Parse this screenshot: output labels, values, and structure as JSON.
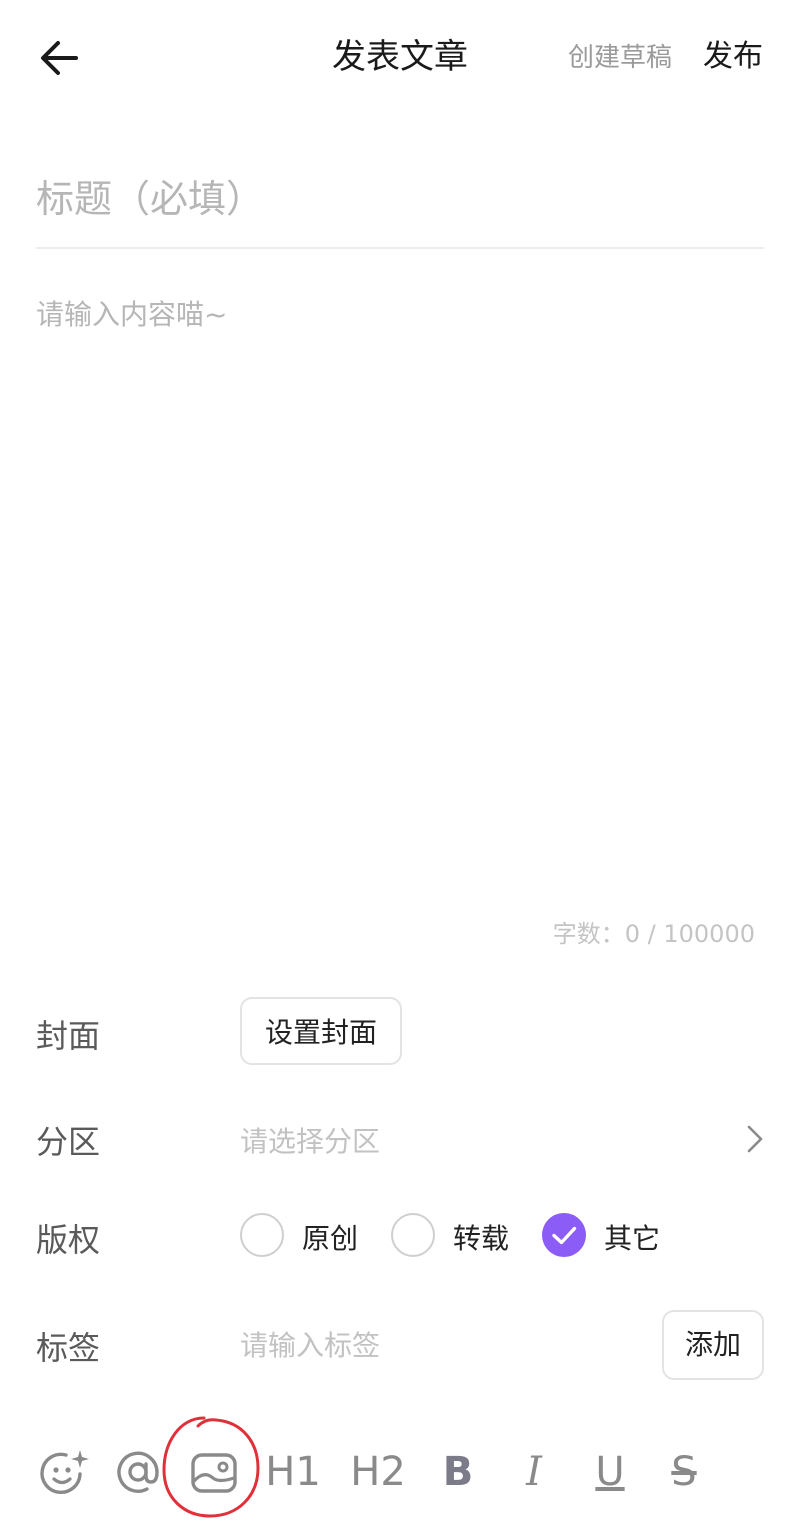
{
  "header": {
    "title": "发表文章",
    "draft_label": "创建草稿",
    "publish_label": "发布"
  },
  "editor": {
    "title_placeholder": "标题（必填）",
    "content_placeholder": "请输入内容喵~",
    "word_count": "字数：0 / 100000"
  },
  "form": {
    "cover": {
      "label": "封面",
      "button_label": "设置封面"
    },
    "partition": {
      "label": "分区",
      "placeholder": "请选择分区"
    },
    "copyright": {
      "label": "版权",
      "options": [
        {
          "label": "原创",
          "checked": false
        },
        {
          "label": "转载",
          "checked": false
        },
        {
          "label": "其它",
          "checked": true
        }
      ]
    },
    "tags": {
      "label": "标签",
      "placeholder": "请输入标签",
      "add_label": "添加"
    }
  },
  "toolbar": {
    "items": [
      {
        "icon": "emoji-sparkle-icon"
      },
      {
        "icon": "mention-at-icon"
      },
      {
        "icon": "image-icon",
        "annotated": true
      },
      {
        "label": "H1"
      },
      {
        "label": "H2"
      },
      {
        "label": "B"
      },
      {
        "label": "I"
      },
      {
        "label": "U"
      },
      {
        "label": "S"
      }
    ]
  },
  "colors": {
    "accent": "#8b5cf6",
    "annotation": "#e0303a"
  }
}
